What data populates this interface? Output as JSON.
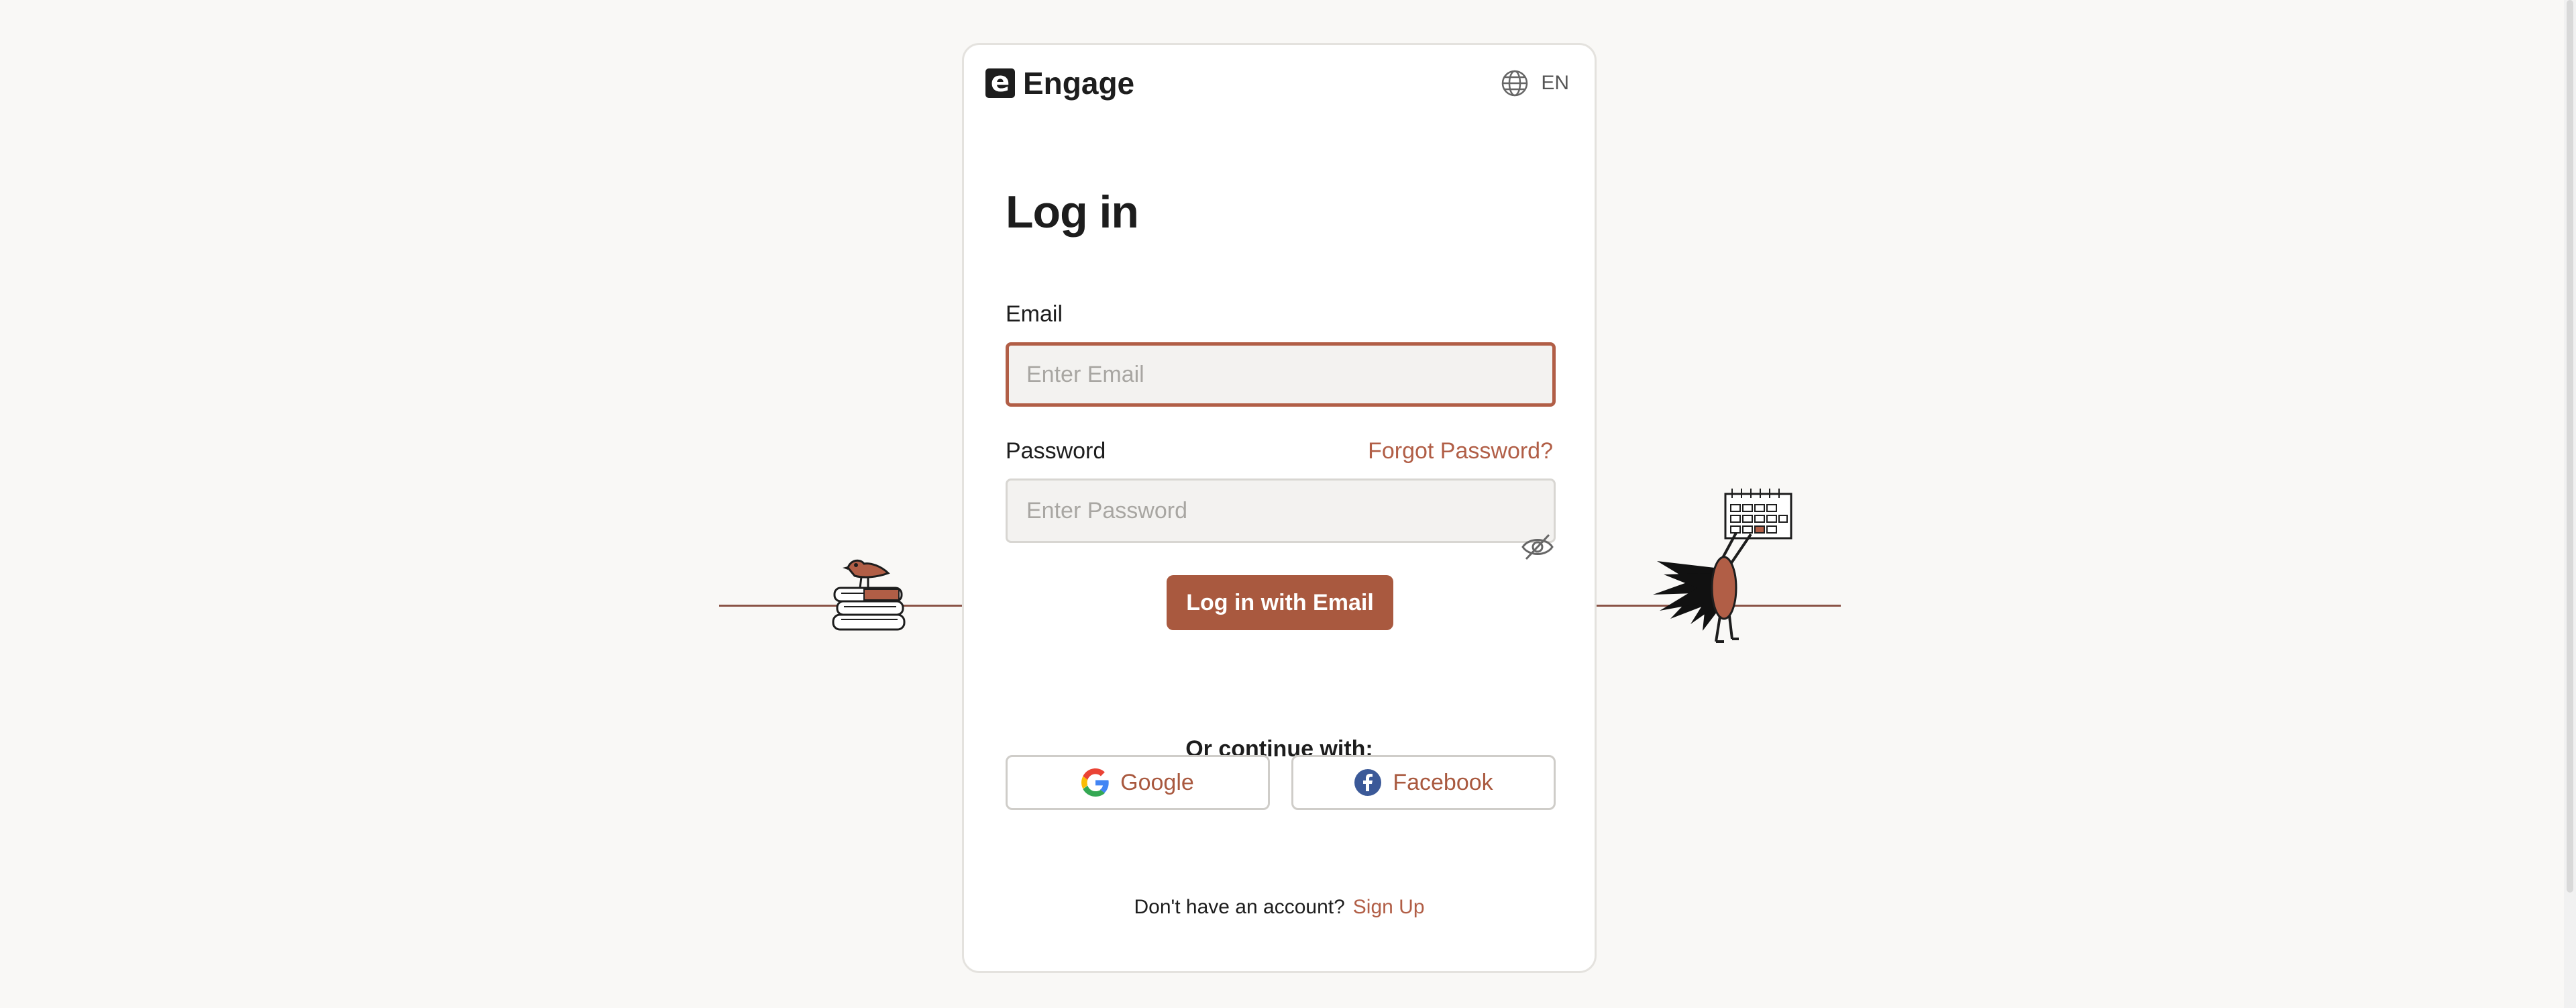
{
  "brand": {
    "logo_letter": "e",
    "name": "Engage"
  },
  "language": {
    "icon": "globe-icon",
    "code": "EN"
  },
  "form": {
    "title": "Log in",
    "email_label": "Email",
    "email_placeholder": "Enter Email",
    "email_value": "",
    "password_label": "Password",
    "forgot_password": "Forgot Password?",
    "password_placeholder": "Enter Password",
    "password_value": "",
    "password_toggle_icon": "eye-off-icon",
    "submit_label": "Log in with Email"
  },
  "social": {
    "heading": "Or continue with:",
    "google_label": "Google",
    "google_icon": "google-icon",
    "facebook_label": "Facebook",
    "facebook_icon": "facebook-icon"
  },
  "signup": {
    "prompt": "Don't have an account?",
    "link": "Sign Up"
  },
  "colors": {
    "accent": "#a9593f",
    "background": "#f9f8f6",
    "text": "#1d1d1d"
  }
}
